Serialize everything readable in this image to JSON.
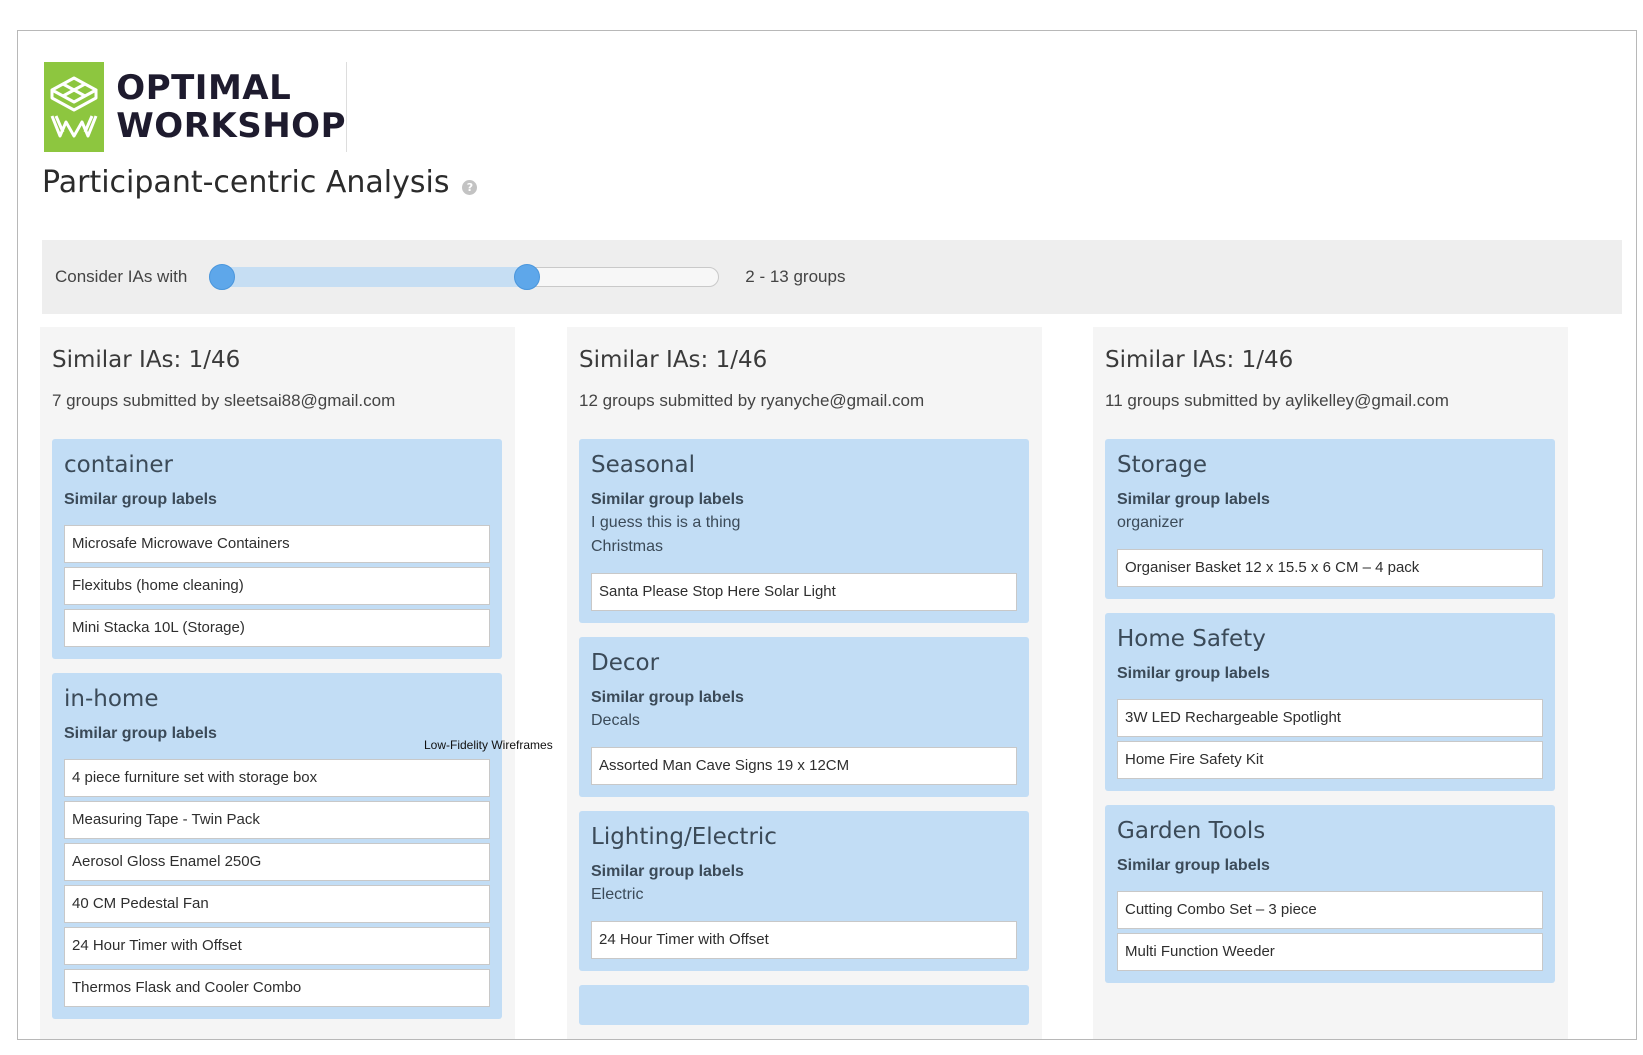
{
  "brand": {
    "line1": "OPTIMAL",
    "line2": "WORKSHOP",
    "color": "#8dc63f"
  },
  "page": {
    "title": "Participant-centric Analysis",
    "help_icon": "question-circle-icon"
  },
  "filter": {
    "label": "Consider IAs with",
    "range_text": "2 - 13 groups",
    "slider_low": 0,
    "slider_high": 0.63
  },
  "overlay_label": "Low-Fidelity Wireframes",
  "columns": [
    {
      "title": "Similar IAs: 1/46",
      "subtitle": "7 groups submitted by sleetsai88@gmail.com",
      "groups": [
        {
          "name": "container",
          "similar_heading": "Similar group labels",
          "similar_labels": [],
          "cards": [
            "Microsafe Microwave Containers",
            "Flexitubs (home cleaning)",
            "Mini Stacka 10L (Storage)"
          ]
        },
        {
          "name": "in-home",
          "similar_heading": "Similar group labels",
          "similar_labels": [],
          "cards": [
            "4 piece furniture set with storage box",
            "Measuring Tape - Twin Pack",
            "Aerosol Gloss Enamel 250G",
            "40 CM Pedestal Fan",
            "24 Hour Timer with Offset",
            "Thermos Flask and Cooler Combo"
          ]
        }
      ]
    },
    {
      "title": "Similar IAs: 1/46",
      "subtitle": "12 groups submitted by ryanyche@gmail.com",
      "groups": [
        {
          "name": "Seasonal",
          "similar_heading": "Similar group labels",
          "similar_labels": [
            "I guess this is a thing",
            "Christmas"
          ],
          "cards": [
            "Santa Please Stop Here Solar Light"
          ]
        },
        {
          "name": "Decor",
          "similar_heading": "Similar group labels",
          "similar_labels": [
            "Decals"
          ],
          "cards": [
            "Assorted Man Cave Signs 19 x 12CM"
          ]
        },
        {
          "name": "Lighting/Electric",
          "similar_heading": "Similar group labels",
          "similar_labels": [
            "Electric"
          ],
          "cards": [
            "24 Hour Timer with Offset"
          ]
        }
      ]
    },
    {
      "title": "Similar IAs: 1/46",
      "subtitle": "11 groups submitted by aylikelley@gmail.com",
      "groups": [
        {
          "name": "Storage",
          "similar_heading": "Similar group labels",
          "similar_labels": [
            "organizer"
          ],
          "cards": [
            "Organiser Basket 12 x 15.5 x 6 CM – 4 pack"
          ]
        },
        {
          "name": "Home Safety",
          "similar_heading": "Similar group labels",
          "similar_labels": [],
          "cards": [
            "3W LED Rechargeable Spotlight",
            "Home Fire Safety Kit"
          ]
        },
        {
          "name": "Garden Tools",
          "similar_heading": "Similar group labels",
          "similar_labels": [],
          "cards": [
            "Cutting Combo Set – 3 piece",
            "Multi Function Weeder"
          ]
        }
      ]
    }
  ]
}
